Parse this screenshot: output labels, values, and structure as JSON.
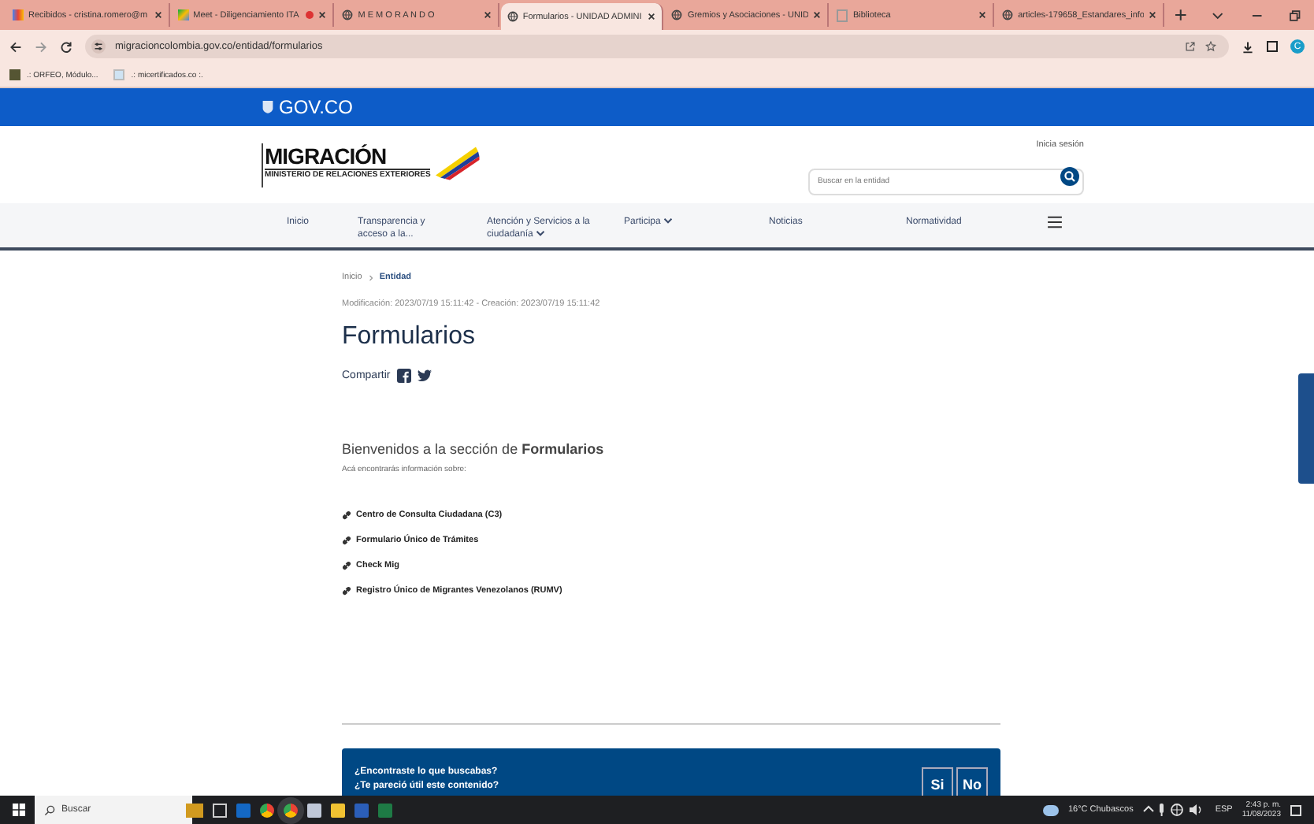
{
  "browser": {
    "tabs": [
      {
        "label": "Recibidos - cristina.romero@m",
        "selected": false,
        "kind": "mail",
        "recording": false
      },
      {
        "label": "Meet - Diligenciamiento ITA",
        "selected": false,
        "kind": "meet",
        "recording": true
      },
      {
        "label": "M E M O R A N D O",
        "selected": false,
        "kind": "globe",
        "recording": false
      },
      {
        "label": "Formularios - UNIDAD ADMINI",
        "selected": true,
        "kind": "globe",
        "recording": false
      },
      {
        "label": "Gremios y Asociaciones - UNID",
        "selected": false,
        "kind": "globe",
        "recording": false
      },
      {
        "label": "Biblioteca",
        "selected": false,
        "kind": "blank",
        "recording": false
      },
      {
        "label": "articles-179658_Estandares_info",
        "selected": false,
        "kind": "globe",
        "recording": false
      }
    ],
    "url": "migracioncolombia.gov.co/entidad/formularios",
    "profile_initial": "C",
    "bookmarks": [
      {
        "label": ".: ORFEO, Módulo..."
      },
      {
        "label": ".: micertificados.co :."
      }
    ]
  },
  "gov_bar": {
    "label": "GOV.CO"
  },
  "header": {
    "logo_text": "MIGRACIÓN",
    "logo_subtext": "MINISTERIO DE RELACIONES EXTERIORES",
    "login": "Inicia sesión",
    "search": {
      "placeholder": "Buscar en la entidad"
    }
  },
  "nav": [
    {
      "label": "Inicio",
      "dropdown": false
    },
    {
      "label": "Transparencia y acceso a la...",
      "dropdown": false
    },
    {
      "label": "Atención y Servicios a la ciudadanía",
      "dropdown": true
    },
    {
      "label": "Participa",
      "dropdown": true
    },
    {
      "label": "Noticias",
      "dropdown": false
    },
    {
      "label": "Normatividad",
      "dropdown": false
    }
  ],
  "breadcrumb": [
    {
      "label": "Inicio",
      "current": false
    },
    {
      "label": "Entidad",
      "current": true
    }
  ],
  "dates": "Modificación: 2023/07/19 15:11:42 - Creación: 2023/07/19 15:11:42",
  "title": "Formularios",
  "share": {
    "label": "Compartir"
  },
  "intro": {
    "heading": "Bienvenidos a la sección de **Formularios**",
    "text": "Acá encontrarás información sobre:"
  },
  "links": [
    "Centro de Consulta Ciudadana (C3)",
    "Formulario Único de Trámites",
    "Check Mig",
    "Registro Único de Migrantes Venezolanos (RUMV)"
  ],
  "feedback": {
    "questions": [
      "¿Encontraste lo que buscabas?",
      "¿Te pareció útil este contenido?"
    ],
    "buttons": [
      "Si",
      "No"
    ]
  },
  "taskbar": {
    "search": "Buscar",
    "weather": "16°C  Chubascos",
    "language": "ESP",
    "time": "2:43 p. m.",
    "date": "11/08/2023"
  }
}
